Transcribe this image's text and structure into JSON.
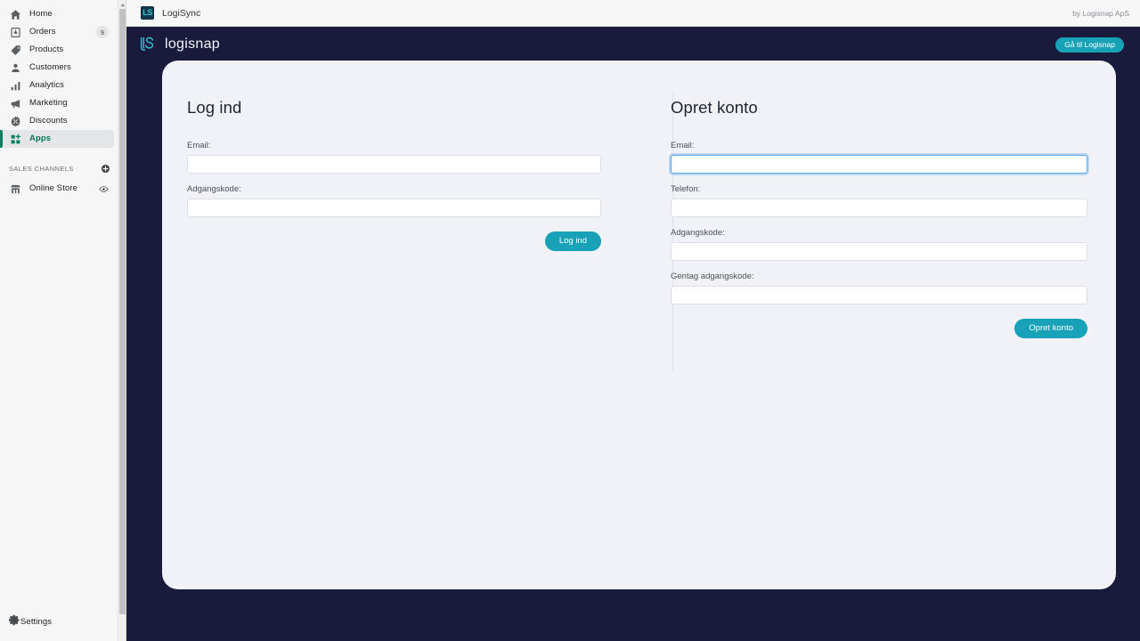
{
  "admin_sidebar": {
    "nav_items": [
      {
        "label": "Home",
        "icon": "home-icon",
        "badge": null,
        "active": false
      },
      {
        "label": "Orders",
        "icon": "orders-icon",
        "badge": "9",
        "active": false
      },
      {
        "label": "Products",
        "icon": "products-icon",
        "badge": null,
        "active": false
      },
      {
        "label": "Customers",
        "icon": "customers-icon",
        "badge": null,
        "active": false
      },
      {
        "label": "Analytics",
        "icon": "analytics-icon",
        "badge": null,
        "active": false
      },
      {
        "label": "Marketing",
        "icon": "marketing-icon",
        "badge": null,
        "active": false
      },
      {
        "label": "Discounts",
        "icon": "discounts-icon",
        "badge": null,
        "active": false
      },
      {
        "label": "Apps",
        "icon": "apps-icon",
        "badge": null,
        "active": true
      }
    ],
    "sales_channels": {
      "title": "SALES CHANNELS",
      "add_icon": "plus-circle-icon",
      "items": [
        {
          "label": "Online Store",
          "icon": "store-icon",
          "action_icon": "eye-icon"
        }
      ]
    },
    "settings": {
      "label": "Settings",
      "icon": "gear-icon"
    },
    "accent_active": "#008060"
  },
  "app_titlebar": {
    "favicon_text": "LS",
    "title": "LogiSync",
    "byline": "by Logisnap ApS"
  },
  "brandbar": {
    "logo_mark": "ls-monogram-icon",
    "wordmark": "logisnap",
    "goto_button": "Gå til Logisnap",
    "bg_color": "#1a1a3d",
    "accent_color": "#17a2b8"
  },
  "login_form": {
    "title": "Log ind",
    "fields": [
      {
        "label": "Email:",
        "value": "",
        "placeholder": "",
        "type": "email",
        "focused": false
      },
      {
        "label": "Adgangskode:",
        "value": "",
        "placeholder": "",
        "type": "password",
        "focused": false
      }
    ],
    "submit_label": "Log ind"
  },
  "signup_form": {
    "title": "Opret konto",
    "fields": [
      {
        "label": "Email:",
        "value": "",
        "placeholder": "",
        "type": "email",
        "focused": true
      },
      {
        "label": "Telefon:",
        "value": "",
        "placeholder": "",
        "type": "tel",
        "focused": false
      },
      {
        "label": "Adgangskode:",
        "value": "",
        "placeholder": "",
        "type": "password",
        "focused": false
      },
      {
        "label": "Gentag adgangskode:",
        "value": "",
        "placeholder": "",
        "type": "password",
        "focused": false
      }
    ],
    "submit_label": "Opret konto"
  }
}
